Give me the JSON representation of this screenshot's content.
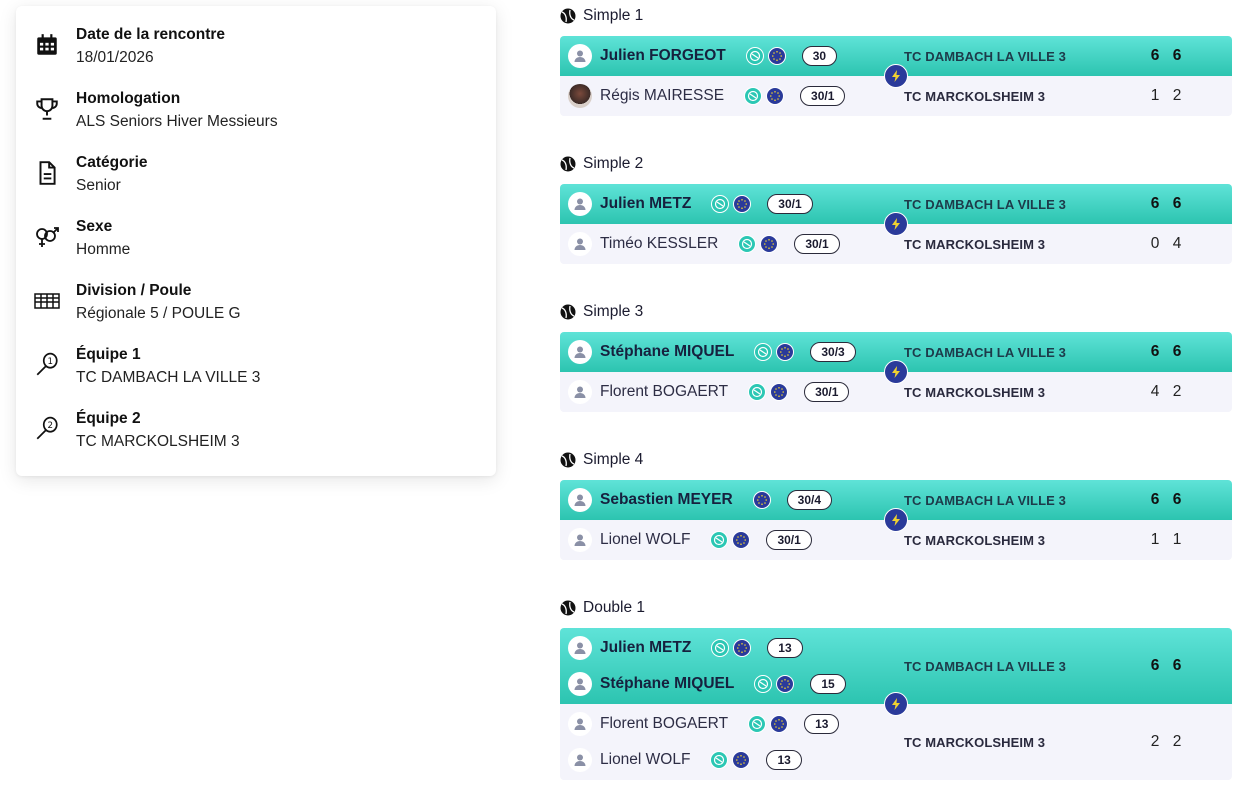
{
  "info": [
    {
      "icon": "calendar-icon",
      "label": "Date de la rencontre",
      "value": "18/01/2026"
    },
    {
      "icon": "trophy-icon",
      "label": "Homologation",
      "value": "ALS Seniors Hiver Messieurs"
    },
    {
      "icon": "document-icon",
      "label": "Catégorie",
      "value": "Senior"
    },
    {
      "icon": "gender-icon",
      "label": "Sexe",
      "value": "Homme"
    },
    {
      "icon": "bracket-icon",
      "label": "Division / Poule",
      "value": "Régionale 5 / POULE G"
    },
    {
      "icon": "racket-1-icon",
      "label": "Équipe 1",
      "value": "TC DAMBACH LA VILLE 3"
    },
    {
      "icon": "racket-2-icon",
      "label": "Équipe 2",
      "value": "TC MARCKOLSHEIM 3"
    }
  ],
  "matches": [
    {
      "title": "Simple 1",
      "team1": {
        "name": "TC DAMBACH LA VILLE 3",
        "scores": [
          "6",
          "6"
        ],
        "players": [
          {
            "name": "Julien FORGEOT",
            "badges": [
              "teal",
              "blue"
            ],
            "rank": "30"
          }
        ]
      },
      "team2": {
        "name": "TC MARCKOLSHEIM 3",
        "scores": [
          "1",
          "2"
        ],
        "players": [
          {
            "name": "Régis MAIRESSE",
            "badges": [
              "teal",
              "blue"
            ],
            "rank": "30/1",
            "photo": true
          }
        ]
      }
    },
    {
      "title": "Simple 2",
      "team1": {
        "name": "TC DAMBACH LA VILLE 3",
        "scores": [
          "6",
          "6"
        ],
        "players": [
          {
            "name": "Julien METZ",
            "badges": [
              "teal",
              "blue"
            ],
            "rank": "30/1"
          }
        ]
      },
      "team2": {
        "name": "TC MARCKOLSHEIM 3",
        "scores": [
          "0",
          "4"
        ],
        "players": [
          {
            "name": "Timéo KESSLER",
            "badges": [
              "teal",
              "blue"
            ],
            "rank": "30/1"
          }
        ]
      }
    },
    {
      "title": "Simple 3",
      "team1": {
        "name": "TC DAMBACH LA VILLE 3",
        "scores": [
          "6",
          "6"
        ],
        "players": [
          {
            "name": "Stéphane MIQUEL",
            "badges": [
              "teal",
              "blue"
            ],
            "rank": "30/3"
          }
        ]
      },
      "team2": {
        "name": "TC MARCKOLSHEIM 3",
        "scores": [
          "4",
          "2"
        ],
        "players": [
          {
            "name": "Florent BOGAERT",
            "badges": [
              "teal",
              "blue"
            ],
            "rank": "30/1"
          }
        ]
      }
    },
    {
      "title": "Simple 4",
      "team1": {
        "name": "TC DAMBACH LA VILLE 3",
        "scores": [
          "6",
          "6"
        ],
        "players": [
          {
            "name": "Sebastien MEYER",
            "badges": [
              "blue"
            ],
            "rank": "30/4"
          }
        ]
      },
      "team2": {
        "name": "TC MARCKOLSHEIM 3",
        "scores": [
          "1",
          "1"
        ],
        "players": [
          {
            "name": "Lionel WOLF",
            "badges": [
              "teal",
              "blue"
            ],
            "rank": "30/1"
          }
        ]
      }
    },
    {
      "title": "Double 1",
      "team1": {
        "name": "TC DAMBACH LA VILLE 3",
        "scores": [
          "6",
          "6"
        ],
        "players": [
          {
            "name": "Julien METZ",
            "badges": [
              "teal",
              "blue"
            ],
            "rank": "13"
          },
          {
            "name": "Stéphane MIQUEL",
            "badges": [
              "teal",
              "blue"
            ],
            "rank": "15"
          }
        ]
      },
      "team2": {
        "name": "TC MARCKOLSHEIM 3",
        "scores": [
          "2",
          "2"
        ],
        "players": [
          {
            "name": "Florent BOGAERT",
            "badges": [
              "teal",
              "blue"
            ],
            "rank": "13"
          },
          {
            "name": "Lionel WOLF",
            "badges": [
              "teal",
              "blue"
            ],
            "rank": "13"
          }
        ]
      }
    }
  ],
  "colors": {
    "accent_top": "#2cc4b0",
    "accent_light": "#5fe3d8",
    "blue": "#2a3a9a",
    "row_bottom": "#f4f4fb"
  }
}
